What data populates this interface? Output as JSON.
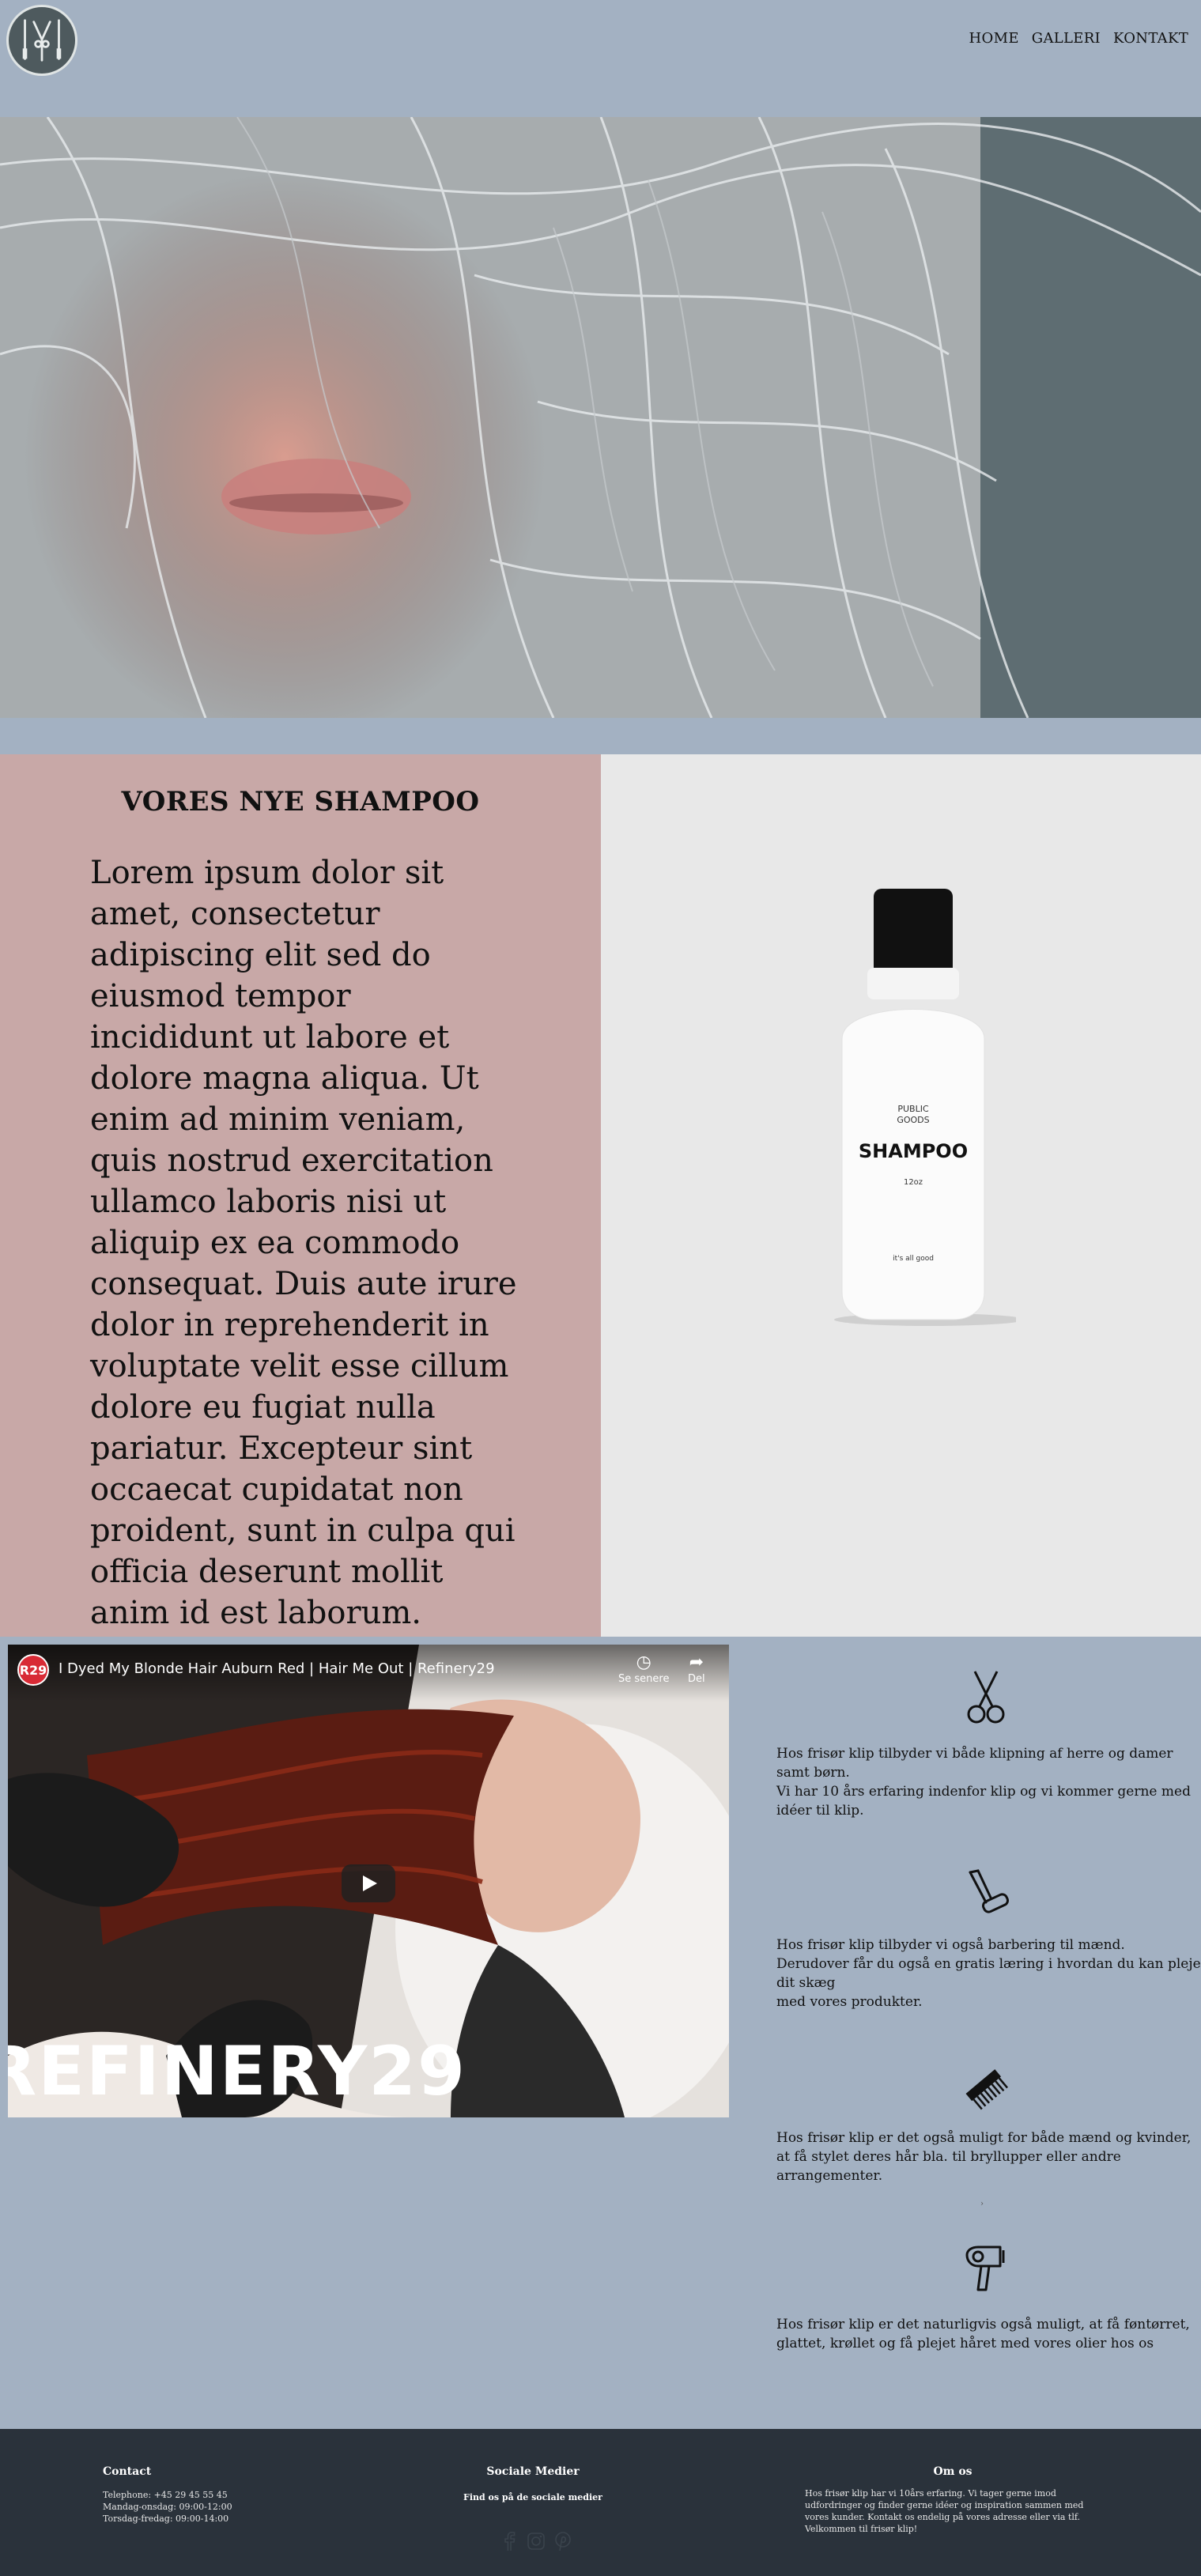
{
  "header": {
    "logo_icon": "salon-tools-logo-icon",
    "nav": [
      {
        "label": "HOME"
      },
      {
        "label": "GALLERI"
      },
      {
        "label": "KONTAKT"
      }
    ]
  },
  "hero": {
    "image": "grey-hair-woman-photo"
  },
  "product": {
    "title": "VORES NYE SHAMPOO",
    "body": "Lorem ipsum dolor sit amet, consectetur adipiscing elit sed do eiusmod tempor incididunt ut labore et dolore magna aliqua. Ut enim ad minim veniam, quis nostrud exercitation ullamco laboris nisi ut aliquip ex ea commodo consequat. Duis aute irure dolor in reprehenderit in voluptate velit esse cillum dolore eu fugiat nulla pariatur. Excepteur sint occaecat cupidatat non proident, sunt in culpa qui officia deserunt mollit anim id est laborum.",
    "bottle": {
      "brand_line1": "PUBLIC",
      "brand_line2": "GOODS",
      "name": "SHAMPOO",
      "size": "12oz",
      "tagline": "it's all good"
    }
  },
  "video": {
    "channel_badge": "R29",
    "title": "I Dyed My Blonde Hair Auburn Red | Hair Me Out | Refinery29",
    "watch_later_label": "Se senere",
    "share_label": "Del",
    "brand_overlay": "REFINERY29"
  },
  "services": [
    {
      "icon": "scissors-icon",
      "lines": [
        "Hos frisør klip tilbyder vi både klipning af herre og damer samt børn.",
        "Vi har 10 års erfaring indenfor klip og vi kommer gerne med idéer til klip."
      ]
    },
    {
      "icon": "razor-icon",
      "lines": [
        "Hos frisør klip tilbyder vi også barbering til mænd.",
        "Derudover får du også en gratis læring i hvordan du kan pleje dit skæg",
        "med vores produkter."
      ]
    },
    {
      "icon": "comb-icon",
      "lines": [
        "Hos frisør klip er det også muligt for både mænd og kvinder, at få stylet deres hår bla. til bryllupper eller andre arrangementer."
      ]
    },
    {
      "icon": "hair-dryer-icon",
      "lines": [
        "Hos frisør klip er det naturligvis også muligt, at få føntørret, glattet, krøllet og få plejet håret med vores olier hos os"
      ]
    }
  ],
  "footer": {
    "contact": {
      "heading": "Contact",
      "lines": [
        "Telephone: +45 29 45 55 45",
        "Mandag-onsdag: 09:00-12:00",
        "Torsdag-fredag: 09:00-14:00"
      ]
    },
    "social": {
      "heading": "Sociale Medier",
      "subtitle": "Find os på de sociale medier",
      "icons": [
        "facebook-icon",
        "instagram-icon",
        "pinterest-icon"
      ]
    },
    "about": {
      "heading": "Om os",
      "lines": [
        "Hos frisør klip har vi 10års erfaring. Vi tager gerne imod",
        "udfordringer og finder gerne idéer og inspiration sammen med",
        "vores kunder. Kontakt os endelig på vores adresse eller via tlf.",
        "Velkommen til frisør klip!"
      ]
    }
  }
}
